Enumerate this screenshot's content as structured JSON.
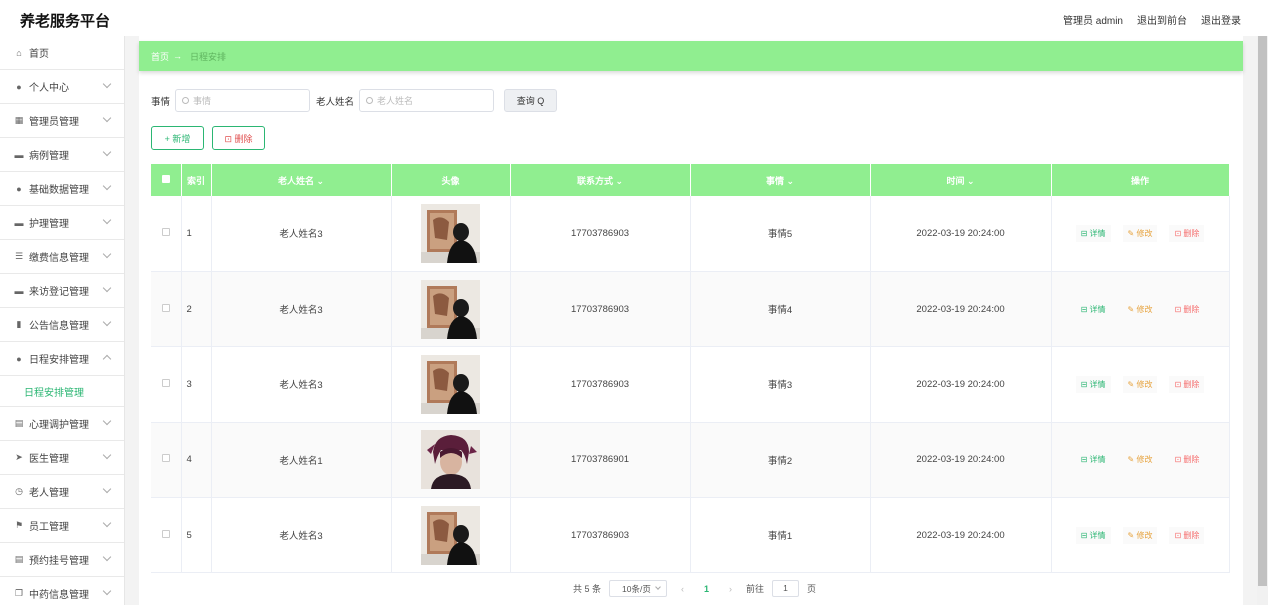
{
  "app": {
    "title": "养老服务平台"
  },
  "top_links": {
    "admin": "管理员 admin",
    "front": "退出到前台",
    "logout": "退出登录"
  },
  "sidebar": {
    "items": [
      {
        "label": "首页",
        "icon": "home-icon",
        "glyph": "⌂",
        "chevron": false
      },
      {
        "label": "个人中心",
        "icon": "user-icon",
        "glyph": "●",
        "chevron": true
      },
      {
        "label": "管理员管理",
        "icon": "grid-icon",
        "glyph": "▦",
        "chevron": true
      },
      {
        "label": "病例管理",
        "icon": "monitor-icon",
        "glyph": "▬",
        "chevron": true
      },
      {
        "label": "基础数据管理",
        "icon": "person-icon",
        "glyph": "●",
        "chevron": true
      },
      {
        "label": "护理管理",
        "icon": "monitor-icon",
        "glyph": "▬",
        "chevron": true
      },
      {
        "label": "缴费信息管理",
        "icon": "list-icon",
        "glyph": "☰",
        "chevron": true
      },
      {
        "label": "来访登记管理",
        "icon": "monitor-icon",
        "glyph": "▬",
        "chevron": true
      },
      {
        "label": "公告信息管理",
        "icon": "chart-icon",
        "glyph": "▮",
        "chevron": true
      },
      {
        "label": "日程安排管理",
        "icon": "location-icon",
        "glyph": "●",
        "chevron": true,
        "open": true
      },
      {
        "label": "心理调护管理",
        "icon": "clipboard-icon",
        "glyph": "▤",
        "chevron": true
      },
      {
        "label": "医生管理",
        "icon": "send-icon",
        "glyph": "➤",
        "chevron": true
      },
      {
        "label": "老人管理",
        "icon": "clock-icon",
        "glyph": "◷",
        "chevron": true
      },
      {
        "label": "员工管理",
        "icon": "flag-icon",
        "glyph": "⚑",
        "chevron": true
      },
      {
        "label": "预约挂号管理",
        "icon": "clipboard-icon",
        "glyph": "▤",
        "chevron": true
      },
      {
        "label": "中药信息管理",
        "icon": "copy-icon",
        "glyph": "❐",
        "chevron": true
      }
    ],
    "submenu_label": "日程安排管理"
  },
  "breadcrumb": {
    "home": "首页",
    "arrow": "→",
    "current": "日程安排"
  },
  "search": {
    "label1": "事情",
    "placeholder1": "事情",
    "label2": "老人姓名",
    "placeholder2": "老人姓名",
    "button": "查询 Q"
  },
  "actions": {
    "add": "+ 新增",
    "delete": "⊡ 删除"
  },
  "table": {
    "headers": [
      "索引",
      "老人姓名 ⌄",
      "头像",
      "联系方式 ⌄",
      "事情 ⌄",
      "时间 ⌄",
      "操作"
    ],
    "rows": [
      {
        "index": "1",
        "name": "老人姓名3",
        "avatar": "photo-a",
        "phone": "17703786903",
        "event": "事情5",
        "time": "2022-03-19 20:24:00"
      },
      {
        "index": "2",
        "name": "老人姓名3",
        "avatar": "photo-a",
        "phone": "17703786903",
        "event": "事情4",
        "time": "2022-03-19 20:24:00"
      },
      {
        "index": "3",
        "name": "老人姓名3",
        "avatar": "photo-a",
        "phone": "17703786903",
        "event": "事情3",
        "time": "2022-03-19 20:24:00"
      },
      {
        "index": "4",
        "name": "老人姓名1",
        "avatar": "photo-b",
        "phone": "17703786901",
        "event": "事情2",
        "time": "2022-03-19 20:24:00"
      },
      {
        "index": "5",
        "name": "老人姓名3",
        "avatar": "photo-a",
        "phone": "17703786903",
        "event": "事情1",
        "time": "2022-03-19 20:24:00"
      }
    ],
    "ops": {
      "detail": "⊟ 详情",
      "edit": "✎ 修改",
      "remove": "⊡ 删除"
    }
  },
  "pagination": {
    "total": "共 5 条",
    "page_size": "10条/页",
    "prev": "‹",
    "current": "1",
    "next": "›",
    "goto": "前往",
    "goto_value": "1",
    "page_unit": "页"
  },
  "colors": {
    "accent": "#90ee90",
    "primary": "#2bb673"
  }
}
